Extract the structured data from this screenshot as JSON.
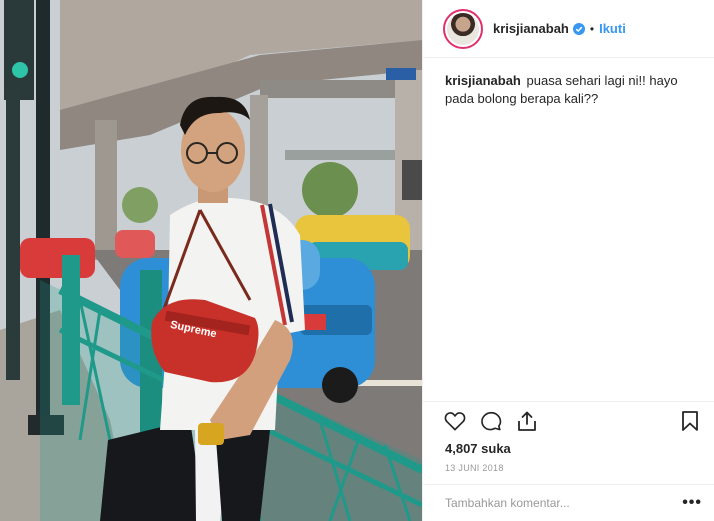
{
  "post": {
    "username": "krisjianabah",
    "verified_icon": "verified-badge-icon",
    "follow_label": "Ikuti",
    "separator": "•",
    "caption_user": "krisjianabah",
    "caption_text": "puasa sehari lagi ni!! hayo pada bolong berapa kali??",
    "likes": "4,807 suka",
    "date": "13 JUNI 2018",
    "comment_placeholder": "Tambahkan komentar...",
    "more_label": "•••"
  },
  "photo": {
    "bag_text": "Supreme",
    "sign_text": ""
  },
  "icons": {
    "like": "heart-icon",
    "comment": "comment-icon",
    "share": "share-icon",
    "save": "bookmark-icon",
    "options": "more-options-icon"
  },
  "colors": {
    "accent": "#3897f0",
    "verified": "#3897f0",
    "text": "#262626",
    "muted": "#999999",
    "bag": "#c8312a",
    "railing": "#1f9a8a"
  }
}
